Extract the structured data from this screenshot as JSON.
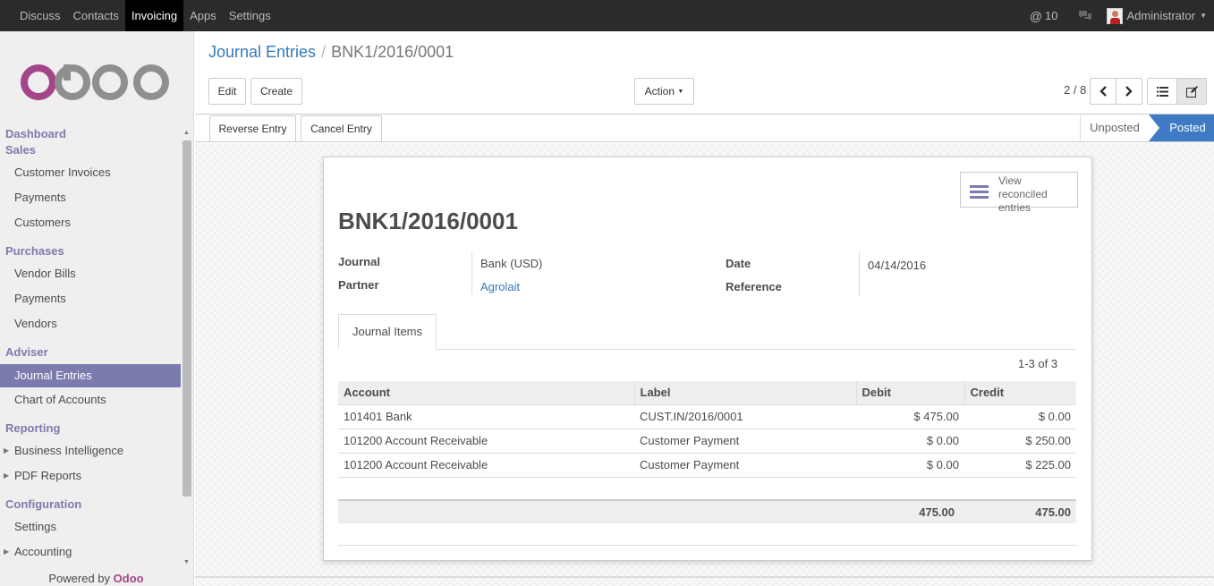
{
  "topbar": {
    "menu": [
      {
        "label": "Discuss",
        "active": false
      },
      {
        "label": "Contacts",
        "active": false
      },
      {
        "label": "Invoicing",
        "active": true
      },
      {
        "label": "Apps",
        "active": false
      },
      {
        "label": "Settings",
        "active": false
      }
    ],
    "mentions_count": "10",
    "user": "Administrator"
  },
  "sidebar": {
    "sections": {
      "dashboard": "Dashboard",
      "sales": "Sales",
      "purchases": "Purchases",
      "adviser": "Adviser",
      "reporting": "Reporting",
      "configuration": "Configuration"
    },
    "items": {
      "customer_invoices": "Customer Invoices",
      "sales_payments": "Payments",
      "customers": "Customers",
      "vendor_bills": "Vendor Bills",
      "purchase_payments": "Payments",
      "vendors": "Vendors",
      "journal_entries": "Journal Entries",
      "chart_of_accounts": "Chart of Accounts",
      "business_intelligence": "Business Intelligence",
      "pdf_reports": "PDF Reports",
      "settings": "Settings",
      "accounting": "Accounting"
    },
    "powered_by": "Powered by",
    "powered_brand": "Odoo"
  },
  "breadcrumb": {
    "parent": "Journal Entries",
    "separator": "/",
    "current": "BNK1/2016/0001"
  },
  "buttons": {
    "edit": "Edit",
    "create": "Create",
    "action": "Action"
  },
  "pager": "2 / 8",
  "statusbar": {
    "reverse": "Reverse Entry",
    "cancel": "Cancel Entry",
    "stages": [
      "Unposted",
      "Posted"
    ],
    "current_stage": "Posted"
  },
  "sheet": {
    "reconciled_button": "View reconciled entries",
    "title": "BNK1/2016/0001",
    "fields": {
      "journal_label": "Journal",
      "journal": "Bank (USD)",
      "partner_label": "Partner",
      "partner": "Agrolait",
      "date_label": "Date",
      "date": "04/14/2016",
      "reference_label": "Reference",
      "reference": ""
    },
    "tab": "Journal Items",
    "list_pager": "1-3 of 3",
    "columns": [
      "Account",
      "Label",
      "Debit",
      "Credit"
    ],
    "rows": [
      {
        "account": "101401 Bank",
        "label": "CUST.IN/2016/0001",
        "debit": "$ 475.00",
        "credit": "$ 0.00"
      },
      {
        "account": "101200 Account Receivable",
        "label": "Customer Payment",
        "debit": "$ 0.00",
        "credit": "$ 250.00"
      },
      {
        "account": "101200 Account Receivable",
        "label": "Customer Payment",
        "debit": "$ 0.00",
        "credit": "$ 225.00"
      }
    ],
    "totals": {
      "debit": "475.00",
      "credit": "475.00"
    }
  },
  "colors": {
    "brand": "#7c7bad",
    "link": "#337ab7",
    "topbar": "#2b2b2b",
    "posted": "#3e7bc4"
  },
  "icons": [
    "mention-icon",
    "chat-icon",
    "caret-down-icon",
    "chevron-left-icon",
    "chevron-right-icon",
    "list-view-icon",
    "form-view-icon",
    "hamburger-icon"
  ]
}
